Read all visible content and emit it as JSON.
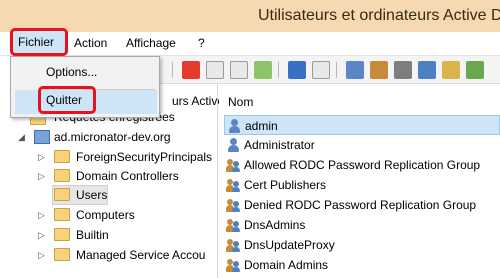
{
  "window": {
    "title": "Utilisateurs et ordinateurs Active Di"
  },
  "menubar": {
    "items": [
      "Fichier",
      "Action",
      "Affichage",
      "?"
    ]
  },
  "file_menu": {
    "options_label": "Options...",
    "quit_label": "Quitter"
  },
  "tree": {
    "root_partial": "urs Active",
    "saved_queries": "Requêtes enregistrées",
    "domain": "ad.micronator-dev.org",
    "children": [
      "ForeignSecurityPrincipals",
      "Domain Controllers",
      "Users",
      "Computers",
      "Builtin",
      "Managed Service Accou"
    ]
  },
  "list": {
    "column_name": "Nom",
    "rows": [
      {
        "name": "admin",
        "icon": "user-icon"
      },
      {
        "name": "Administrator",
        "icon": "user-icon"
      },
      {
        "name": "Allowed RODC Password Replication Group",
        "icon": "group-icon"
      },
      {
        "name": "Cert Publishers",
        "icon": "group-icon"
      },
      {
        "name": "Denied RODC Password Replication Group",
        "icon": "group-icon"
      },
      {
        "name": "DnsAdmins",
        "icon": "group-icon"
      },
      {
        "name": "DnsUpdateProxy",
        "icon": "group-icon"
      },
      {
        "name": "Domain Admins",
        "icon": "group-icon"
      }
    ]
  },
  "colors": {
    "title_bar": "#f6d9b0",
    "highlight": "#cde5f7",
    "callout_red": "#e8121e"
  }
}
